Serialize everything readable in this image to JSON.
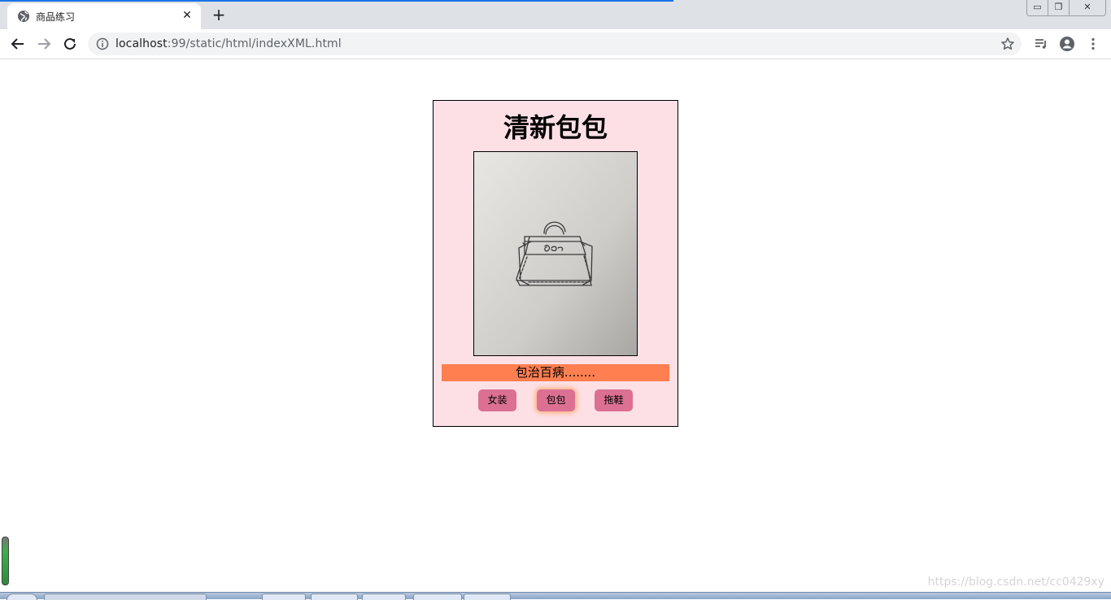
{
  "browser": {
    "tab": {
      "title": "商品练习",
      "close_glyph": "✕",
      "favicon": "globe-icon"
    },
    "new_tab_glyph": "+",
    "window_controls": {
      "minimize": "▭",
      "restore": "❐",
      "close": "✕"
    },
    "address": {
      "host": "localhost",
      "rest": ":99/static/html/indexXML.html"
    },
    "accent_color": "#1a73e8"
  },
  "card": {
    "title": "清新包包",
    "image": "handbag-sketch",
    "description": "包治百病........",
    "background_color": "#fde0e6",
    "description_color": "#ff7f50",
    "button_color": "#db7093",
    "buttons": [
      {
        "label": "女装",
        "active": false
      },
      {
        "label": "包包",
        "active": true
      },
      {
        "label": "拖鞋",
        "active": false
      }
    ]
  },
  "watermark": "https://blog.csdn.net/cc0429xy"
}
